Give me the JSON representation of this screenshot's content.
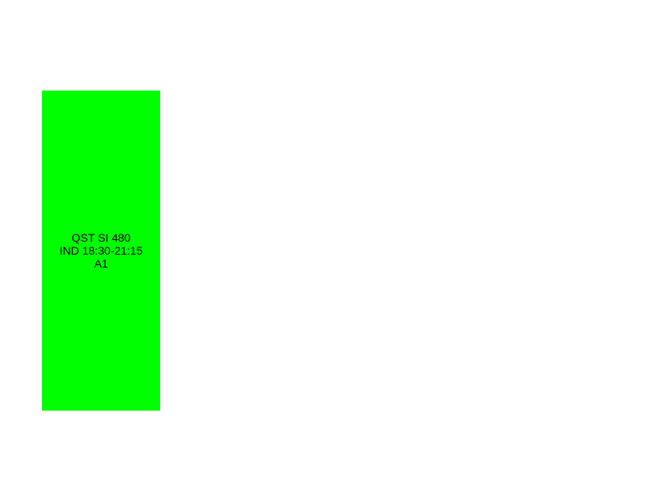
{
  "schedule": {
    "event": {
      "course": "QST SI 480",
      "time": "IND 18:30-21:15",
      "room": "A1",
      "color": "#00ff00"
    }
  }
}
